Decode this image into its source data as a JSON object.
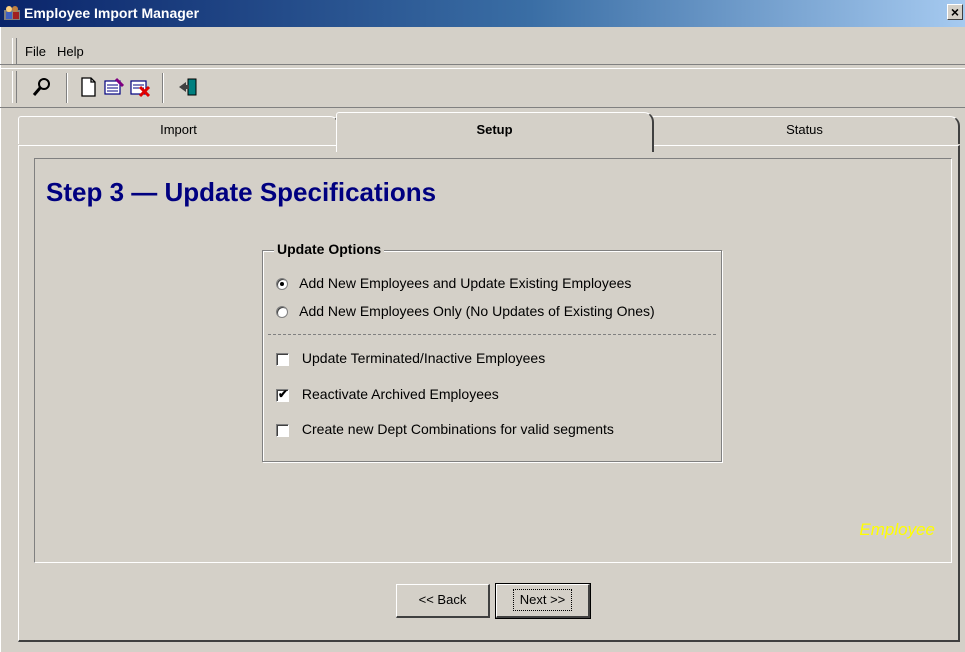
{
  "window": {
    "title": "Employee Import Manager",
    "close_glyph": "×"
  },
  "menu": {
    "items": [
      {
        "label": "File"
      },
      {
        "label": "Help"
      }
    ]
  },
  "toolbar": {
    "buttons": [
      {
        "icon": "search-key-icon"
      },
      {
        "icon": "new-document-icon"
      },
      {
        "icon": "edit-icon"
      },
      {
        "icon": "delete-icon"
      },
      {
        "icon": "exit-icon"
      }
    ]
  },
  "tabs": [
    {
      "label": "Import",
      "active": false
    },
    {
      "label": "Setup",
      "active": true
    },
    {
      "label": "Status",
      "active": false
    }
  ],
  "step": {
    "title": "Step 3 — Update Specifications"
  },
  "update_options": {
    "legend": "Update Options",
    "radios": [
      {
        "label": "Add New Employees and Update Existing Employees",
        "selected": true
      },
      {
        "label": "Add New Employees Only (No Updates of Existing Ones)",
        "selected": false
      }
    ],
    "checkboxes": [
      {
        "label": "Update Terminated/Inactive Employees",
        "checked": false
      },
      {
        "label": "Reactivate Archived Employees",
        "checked": true
      },
      {
        "label": "Create new Dept Combinations for valid segments",
        "checked": false
      }
    ]
  },
  "watermark": {
    "text": "Employee",
    "color": "#ffff00"
  },
  "buttons": {
    "back_label": "<< Back",
    "next_label": "Next >>"
  },
  "colors": {
    "title_blue": "#000080",
    "face": "#d4d0c8"
  }
}
